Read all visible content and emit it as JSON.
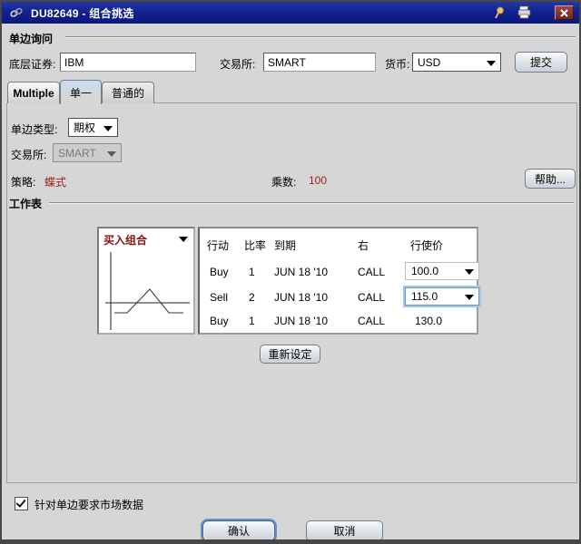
{
  "window": {
    "title": "DU82649 - 组合挑选"
  },
  "icons": {
    "link": "chain-link-icon",
    "pin": "pushpin-icon",
    "printer": "printer-icon",
    "close": "close-icon"
  },
  "query": {
    "section_title": "单边询问",
    "underlying_label": "底层证券:",
    "underlying_value": "IBM",
    "exchange_label": "交易所:",
    "exchange_value": "SMART",
    "currency_label": "货币:",
    "currency_value": "USD",
    "submit_label": "提交"
  },
  "tabs": {
    "multiple": "Multiple",
    "single": "单一",
    "generic": "普通的"
  },
  "legs": {
    "type_label": "单边类型:",
    "type_value": "期权",
    "exchange_label": "交易所:",
    "exchange_value": "SMART",
    "strategy_label": "策略:",
    "strategy_value": "蝶式",
    "multiplier_label": "乘数:",
    "multiplier_value": "100",
    "help_label": "帮助..."
  },
  "worksheet": {
    "section_title": "工作表",
    "combo_selector_label": "买入组合",
    "table": {
      "headers": [
        "行动",
        "比率",
        "到期",
        "右",
        "行使价"
      ],
      "rows": [
        {
          "action": "Buy",
          "ratio": "1",
          "expiry": "JUN 18 '10",
          "right": "CALL",
          "strike": "100.0"
        },
        {
          "action": "Sell",
          "ratio": "2",
          "expiry": "JUN 18 '10",
          "right": "CALL",
          "strike": "115.0"
        },
        {
          "action": "Buy",
          "ratio": "1",
          "expiry": "JUN 18 '10",
          "right": "CALL",
          "strike": "130.0"
        }
      ]
    },
    "reset_label": "重新设定"
  },
  "footer": {
    "market_data_label": "针对单边要求市场数据",
    "checkbox_checked": true,
    "confirm_label": "确认",
    "cancel_label": "取消"
  },
  "colors": {
    "titlebar_blue": "#13228e",
    "accent_red": "#9c1c16",
    "focus_ring": "#a5c6e9",
    "tab_selected_blue": "#c8ddf2"
  }
}
